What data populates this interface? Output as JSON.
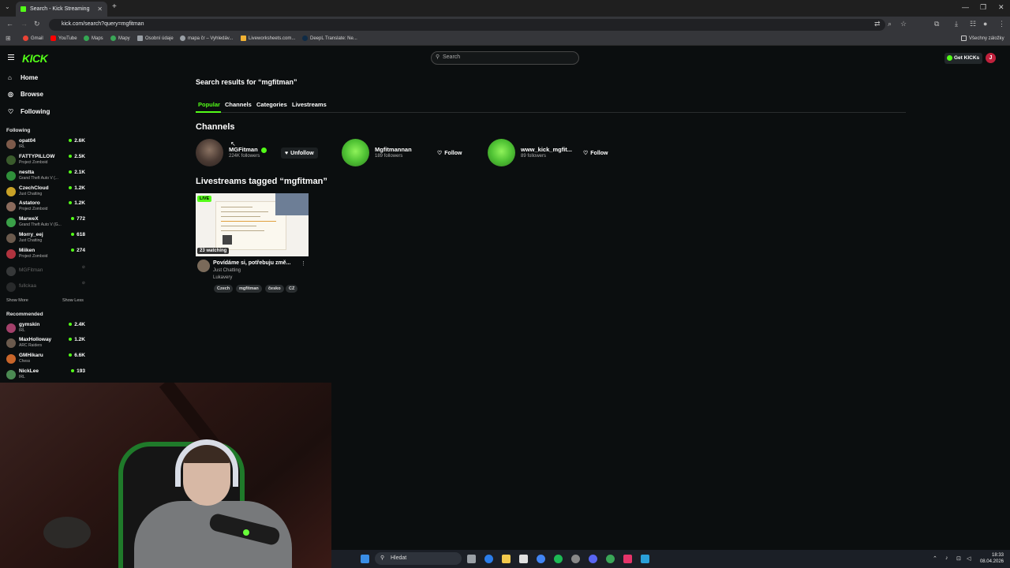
{
  "browser": {
    "tab_title": "Search - Kick Streaming",
    "url": "kick.com/search?query=mgfitman",
    "bookmarks": [
      "Gmail",
      "YouTube",
      "Maps",
      "Mapy",
      "Osobní údaje",
      "mapa čr – Vyhledáv...",
      "Liveworksheets.com...",
      "DeepL Translate: Ne..."
    ],
    "bookmarks_right": "Všechny záložky"
  },
  "kick": {
    "logo": "KICK",
    "search_placeholder": "Search",
    "get_kicks": "Get KICKs",
    "user_initial": "J"
  },
  "sidebar": {
    "nav": [
      {
        "label": "Home",
        "icon": "home-icon"
      },
      {
        "label": "Browse",
        "icon": "compass-icon"
      },
      {
        "label": "Following",
        "icon": "heart-icon"
      }
    ],
    "following_label": "Following",
    "following": [
      {
        "name": "opat04",
        "category": "IRL",
        "viewers": "2.6K",
        "color": "#7d5a4a"
      },
      {
        "name": "FATTYPILLOW",
        "category": "Project Zomboid",
        "viewers": "2.5K",
        "color": "#3a5b2c"
      },
      {
        "name": "nestta",
        "category": "Grand Theft Auto V (...",
        "viewers": "2.1K",
        "color": "#2f8f3a"
      },
      {
        "name": "CzechCloud",
        "category": "Just Chatting",
        "viewers": "1.2K",
        "color": "#c9a227"
      },
      {
        "name": "Astatoro",
        "category": "Project Zomboid",
        "viewers": "1.2K",
        "color": "#8b6b5c"
      },
      {
        "name": "MarweX",
        "category": "Grand Theft Auto V (G...",
        "viewers": "772",
        "color": "#3aa048"
      },
      {
        "name": "Morry_eej",
        "category": "Just Chatting",
        "viewers": "618",
        "color": "#6b5a4d"
      },
      {
        "name": "Miiken",
        "category": "Project Zomboid",
        "viewers": "274",
        "color": "#b0333e"
      }
    ],
    "offline": [
      {
        "name": "MGFitman",
        "color": "#777"
      },
      {
        "name": "fullckaa",
        "color": "#555"
      }
    ],
    "show_more": "Show More",
    "show_less": "Show Less",
    "recommended_label": "Recommended",
    "recommended": [
      {
        "name": "gymskin",
        "category": "IRL",
        "viewers": "2.4K",
        "color": "#a3406a"
      },
      {
        "name": "MaxHolloway",
        "category": "ARC Raiders",
        "viewers": "1.2K",
        "color": "#6b5a4d"
      },
      {
        "name": "GMHikaru",
        "category": "Chess",
        "viewers": "6.6K",
        "color": "#c8652a"
      },
      {
        "name": "NickLee",
        "category": "IRL",
        "viewers": "193",
        "color": "#4b8a52"
      }
    ]
  },
  "main": {
    "title": "Search results for “mgfitman”",
    "tabs": [
      "Popular",
      "Channels",
      "Categories",
      "Livestreams"
    ],
    "channels_heading": "Channels",
    "channels": [
      {
        "name": "MGFitman",
        "followers": "224K followers",
        "button": "Unfollow",
        "verified": true,
        "color": "#5a4a42"
      },
      {
        "name": "Mgfitmannan",
        "followers": "189 followers",
        "button": "Follow",
        "verified": false,
        "color": "#4fc234"
      },
      {
        "name": "www_kick_mgfit...",
        "followers": "89 followers",
        "button": "Follow",
        "verified": false,
        "color": "#4fc234"
      }
    ],
    "livestreams_heading": "Livestreams tagged “mgfitman”",
    "stream": {
      "live_badge": "LIVE",
      "watching": "23 watching",
      "title": "Povídáme si, potřebuju změ...",
      "more": "⋮",
      "category": "Just Chatting",
      "user": "Lukavery",
      "tags": [
        "Czech",
        "mgfitman",
        "česko",
        "CZ"
      ]
    }
  },
  "taskbar": {
    "search_label": "Hledat",
    "time": "18:33",
    "date": "08.04.2026"
  }
}
